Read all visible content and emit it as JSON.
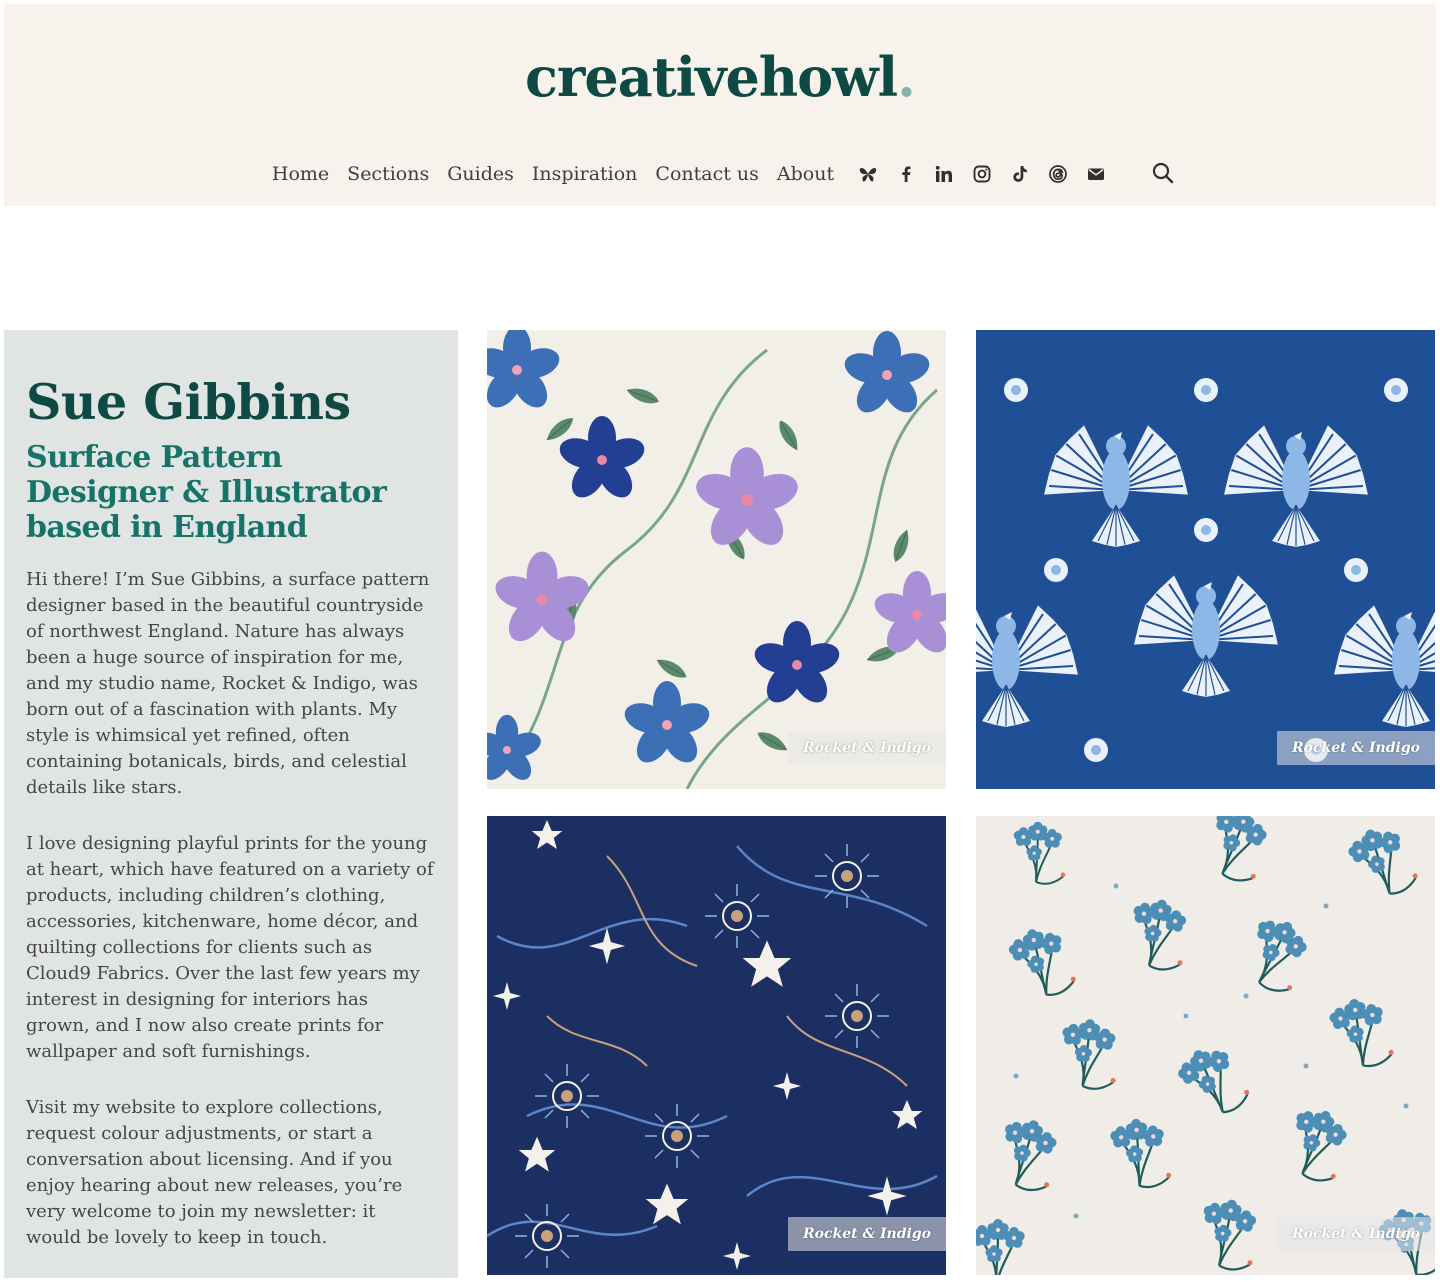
{
  "brand": {
    "logo_text": "creativehowl",
    "logo_dot": ".",
    "colors": {
      "primary": "#0e4a43",
      "secondary": "#177368",
      "accent": "#7fb5ad",
      "header_bg": "#f7f3ec",
      "panel_bg": "#e0e5e4"
    }
  },
  "nav": {
    "links": [
      "Home",
      "Sections",
      "Guides",
      "Inspiration",
      "Contact us",
      "About"
    ],
    "social_icons": [
      "butterfly-icon",
      "facebook-icon",
      "linkedin-icon",
      "instagram-icon",
      "tiktok-icon",
      "threads-icon",
      "email-icon"
    ],
    "search_icon": "search-icon"
  },
  "intro": {
    "name": "Sue Gibbins",
    "role": "Surface Pattern Designer & Illustrator based in England",
    "paragraphs": [
      "Hi there! I’m Sue Gibbins, a surface pattern designer based in the beautiful countryside of northwest England. Nature has always been a huge source of inspiration for me, and my studio name, Rocket & Indigo, was born out of a fascination with plants. My style is whimsical yet refined, often containing botanicals, birds, and celestial details like stars.",
      "I love designing playful prints for the young at heart, which have featured on a variety of products, including children’s clothing, accessories, kitchenware, home décor, and quilting collections for clients such as Cloud9 Fabrics. Over the last few years my interest in designing for interiors has grown, and I now also create prints for wallpaper and soft furnishings.",
      "Visit my website to explore collections, request colour adjustments, or start a conversation about licensing. And if you enjoy hearing about new releases, you’re very welcome to join my newsletter: it would be lovely to keep in touch."
    ]
  },
  "gallery": {
    "watermark": "Rocket & Indigo",
    "tiles": [
      {
        "pattern": "hibiscus-floral",
        "bg": "#f2efe9"
      },
      {
        "pattern": "folk-birds",
        "bg": "#1f4f94"
      },
      {
        "pattern": "celestial-stars",
        "bg": "#1c2f63"
      },
      {
        "pattern": "forget-me-not",
        "bg": "#f0ede8"
      }
    ]
  }
}
